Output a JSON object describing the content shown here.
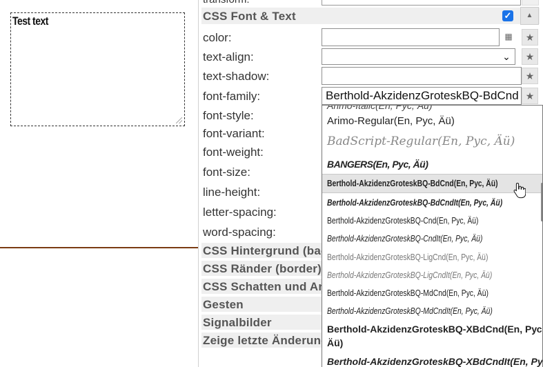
{
  "preview": {
    "text": "Test text"
  },
  "cut_row": {
    "label": "transform:"
  },
  "section_font": {
    "title": "CSS Font & Text",
    "enabled": true
  },
  "properties": {
    "color": "color:",
    "text_align": "text-align:",
    "text_shadow": "text-shadow:",
    "font_family": "font-family:",
    "font_style": "font-style:",
    "font_variant": "font-variant:",
    "font_weight": "font-weight:",
    "font_size": "font-size:",
    "line_height": "line-height:",
    "letter_spacing": "letter-spacing:",
    "word_spacing": "word-spacing:"
  },
  "font_family_value": "Berthold-AkzidenzGroteskBQ-BdCnd",
  "sections_collapsed": [
    "CSS Hintergrund (background)",
    "CSS Ränder (border)",
    "CSS Schatten und Animationen",
    "Gesten",
    "Signalbilder",
    "Zeige letzte Änderungen"
  ],
  "dropdown_items": [
    "Arimo-Italic(En, Рус, Äü)",
    "Arimo-Regular(En, Рус, Äü)",
    "BadScript-Regular(En, Рус, Äü)",
    "BANGERS(En, Рус, Äü)",
    "Berthold-AkzidenzGroteskBQ-BdCnd(En, Рус, Äü)",
    "Berthold-AkzidenzGroteskBQ-BdCndIt(En, Рус, Äü)",
    "Berthold-AkzidenzGroteskBQ-Cnd(En, Рус, Äü)",
    "Berthold-AkzidenzGroteskBQ-CndIt(En, Рус, Äü)",
    "Berthold-AkzidenzGroteskBQ-LigCnd(En, Рус, Äü)",
    "Berthold-AkzidenzGroteskBQ-LigCndIt(En, Рус, Äü)",
    "Berthold-AkzidenzGroteskBQ-MdCnd(En, Рус, Äü)",
    "Berthold-AkzidenzGroteskBQ-MdCndIt(En, Рус, Äü)",
    "Berthold-AkzidenzGroteskBQ-XBdCnd(En, Рус,",
    "Äü)",
    "Berthold-AkzidenzGroteskBQ-XBdCndIt(En, Рус,"
  ],
  "icons": {
    "star": "★",
    "collapse": "▲",
    "check": "✓",
    "chevron": "⌄",
    "picker": "▦"
  }
}
